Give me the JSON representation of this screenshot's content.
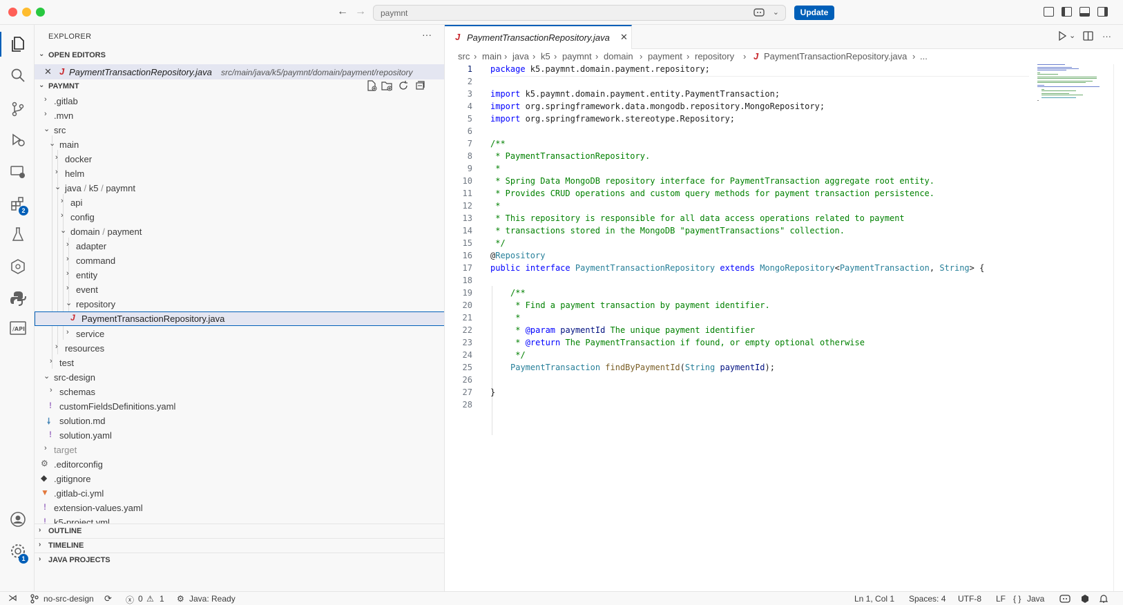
{
  "titlebar": {
    "back": "←",
    "forward": "→",
    "search_text": "paymnt",
    "update_label": "Update"
  },
  "activity": {
    "extensions_badge": "2",
    "settings_badge": "1"
  },
  "sidebar": {
    "title": "EXPLORER",
    "more": "···",
    "open_editors_label": "OPEN EDITORS",
    "open_editor": {
      "name": "PaymentTransactionRepository.java",
      "path": "src/main/java/k5/paymnt/domain/payment/repository"
    },
    "project_label": "PAYMNT",
    "tree": [
      {
        "label": "src/main/java/k5/paymnt/domain/payment/repository"
      }
    ],
    "outline_label": "OUTLINE",
    "timeline_label": "TIMELINE",
    "java_projects_label": "JAVA PROJECTS"
  },
  "files": {
    "gitlab": ".gitlab",
    "mvn": ".mvn",
    "src": "src",
    "main": "main",
    "docker": "docker",
    "helm": "helm",
    "java": "java",
    "k5": "k5",
    "paymnt": "paymnt",
    "api": "api",
    "config": "config",
    "domain": "domain",
    "payment": "payment",
    "adapter": "adapter",
    "command": "command",
    "entity": "entity",
    "event": "event",
    "repository": "repository",
    "repo_file": "PaymentTransactionRepository.java",
    "service": "service",
    "resources": "resources",
    "test": "test",
    "src_design": "src-design",
    "schemas": "schemas",
    "custom_fields": "customFieldsDefinitions.yaml",
    "solution_md": "solution.md",
    "solution_yaml": "solution.yaml",
    "target": "target",
    "editorconfig": ".editorconfig",
    "gitignore": ".gitignore",
    "gitlab_ci": ".gitlab-ci.yml",
    "ext_values": "extension-values.yaml",
    "k5_project": "k5-project.yml",
    "sep": "/"
  },
  "editor": {
    "tab_name": "PaymentTransactionRepository.java",
    "breadcrumbs": [
      "src",
      "main",
      "java",
      "k5",
      "paymnt",
      "domain",
      "payment",
      "repository",
      "PaymentTransactionRepository.java",
      "..."
    ],
    "line_numbers": [
      "1",
      "2",
      "3",
      "4",
      "5",
      "6",
      "7",
      "8",
      "9",
      "10",
      "11",
      "12",
      "13",
      "14",
      "15",
      "16",
      "17",
      "18",
      "19",
      "20",
      "21",
      "22",
      "23",
      "24",
      "25",
      "26",
      "27",
      "28"
    ],
    "code": {
      "l1_kw": "package",
      "l1_rest": " k5.paymnt.domain.payment.repository;",
      "l3_kw": "import",
      "l3_rest": " k5.paymnt.domain.payment.entity.PaymentTransaction;",
      "l4_kw": "import",
      "l4_rest": " org.springframework.data.mongodb.repository.MongoRepository;",
      "l5_kw": "import",
      "l5_rest": " org.springframework.stereotype.Repository;",
      "l7": "/**",
      "l8": " * PaymentTransactionRepository.",
      "l9": " *",
      "l10": " * Spring Data MongoDB repository interface for PaymentTransaction aggregate root entity.",
      "l11": " * Provides CRUD operations and custom query methods for payment transaction persistence.",
      "l12": " *",
      "l13": " * This repository is responsible for all data access operations related to payment",
      "l14": " * transactions stored in the MongoDB \"paymentTransactions\" collection.",
      "l15": " */",
      "l16_at": "@",
      "l16_ann": "Repository",
      "l17_public": "public",
      "l17_interface": "interface",
      "l17_name": "PaymentTransactionRepository",
      "l17_extends": "extends",
      "l17_mongo": "MongoRepository",
      "l17_lt": "<",
      "l17_pt": "PaymentTransaction",
      "l17_comma": ", ",
      "l17_string": "String",
      "l17_end": "> {",
      "l19": "/**",
      "l20": " * Find a payment transaction by payment identifier.",
      "l21": " *",
      "l22_pre": " * ",
      "l22_tag": "@param",
      "l22_name": "paymentId",
      "l22_rest": " The unique payment identifier",
      "l23_pre": " * ",
      "l23_tag": "@return",
      "l23_rest": " The PaymentTransaction if found, or empty optional otherwise",
      "l24": " */",
      "l25_type": "PaymentTransaction",
      "l25_fn": "findByPaymentId",
      "l25_paren": "(",
      "l25_string": "String",
      "l25_param": "paymentId",
      "l25_end": ");",
      "l27": "}"
    }
  },
  "statusbar": {
    "branch": "no-src-design",
    "errors": "0",
    "warnings": "1",
    "java_status": "Java: Ready",
    "position": "Ln 1, Col 1",
    "spaces": "Spaces: 4",
    "encoding": "UTF-8",
    "eol": "LF",
    "language": "Java"
  },
  "colors": {
    "accent": "#005fb8",
    "java_icon": "#c8282d",
    "comment": "#008000",
    "keyword": "#0000ff",
    "type": "#267f99"
  }
}
